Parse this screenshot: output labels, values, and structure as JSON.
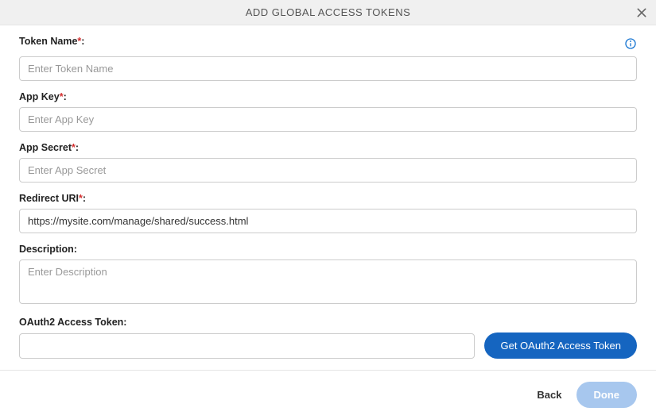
{
  "header": {
    "title": "ADD GLOBAL ACCESS TOKENS"
  },
  "fields": {
    "tokenName": {
      "label": "Token Name",
      "placeholder": "Enter Token Name",
      "value": ""
    },
    "appKey": {
      "label": "App Key",
      "placeholder": "Enter App Key",
      "value": ""
    },
    "appSecret": {
      "label": "App Secret",
      "placeholder": "Enter App Secret",
      "value": ""
    },
    "redirectUri": {
      "label": "Redirect URI",
      "placeholder": "",
      "value": "https://mysite.com/manage/shared/success.html"
    },
    "description": {
      "label": "Description:",
      "placeholder": "Enter Description",
      "value": ""
    },
    "oauthToken": {
      "label": "OAuth2 Access Token:",
      "value": ""
    }
  },
  "buttons": {
    "getToken": "Get OAuth2 Access Token",
    "back": "Back",
    "done": "Done"
  },
  "required_marker": "*",
  "colon": ":"
}
